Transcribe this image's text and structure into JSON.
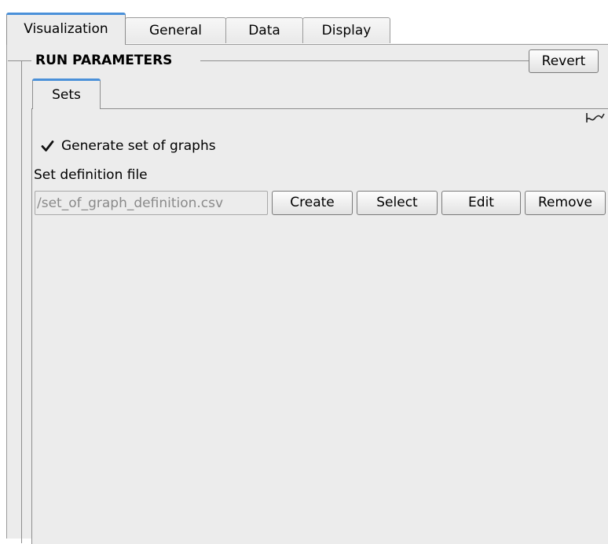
{
  "top_tabs": [
    {
      "label": "Visualization",
      "active": true
    },
    {
      "label": "General",
      "active": false
    },
    {
      "label": "Data",
      "active": false
    },
    {
      "label": "Display",
      "active": false
    }
  ],
  "group": {
    "title": "RUN PARAMETERS",
    "revert_label": "Revert"
  },
  "inner_tabs": [
    {
      "label": "Sets",
      "active": true
    }
  ],
  "sets": {
    "generate_checkbox": {
      "label": "Generate set of graphs",
      "checked": true
    },
    "file_label": "Set definition file",
    "file_value": "/set_of_graph_definition.csv",
    "buttons": {
      "create": "Create",
      "select": "Select",
      "edit": "Edit",
      "remove": "Remove"
    }
  },
  "icons": {
    "graph": "graph-icon",
    "checkmark": "checkmark-icon"
  },
  "colors": {
    "active_tab_accent": "#4a90d9",
    "pane_background": "#ececec"
  }
}
